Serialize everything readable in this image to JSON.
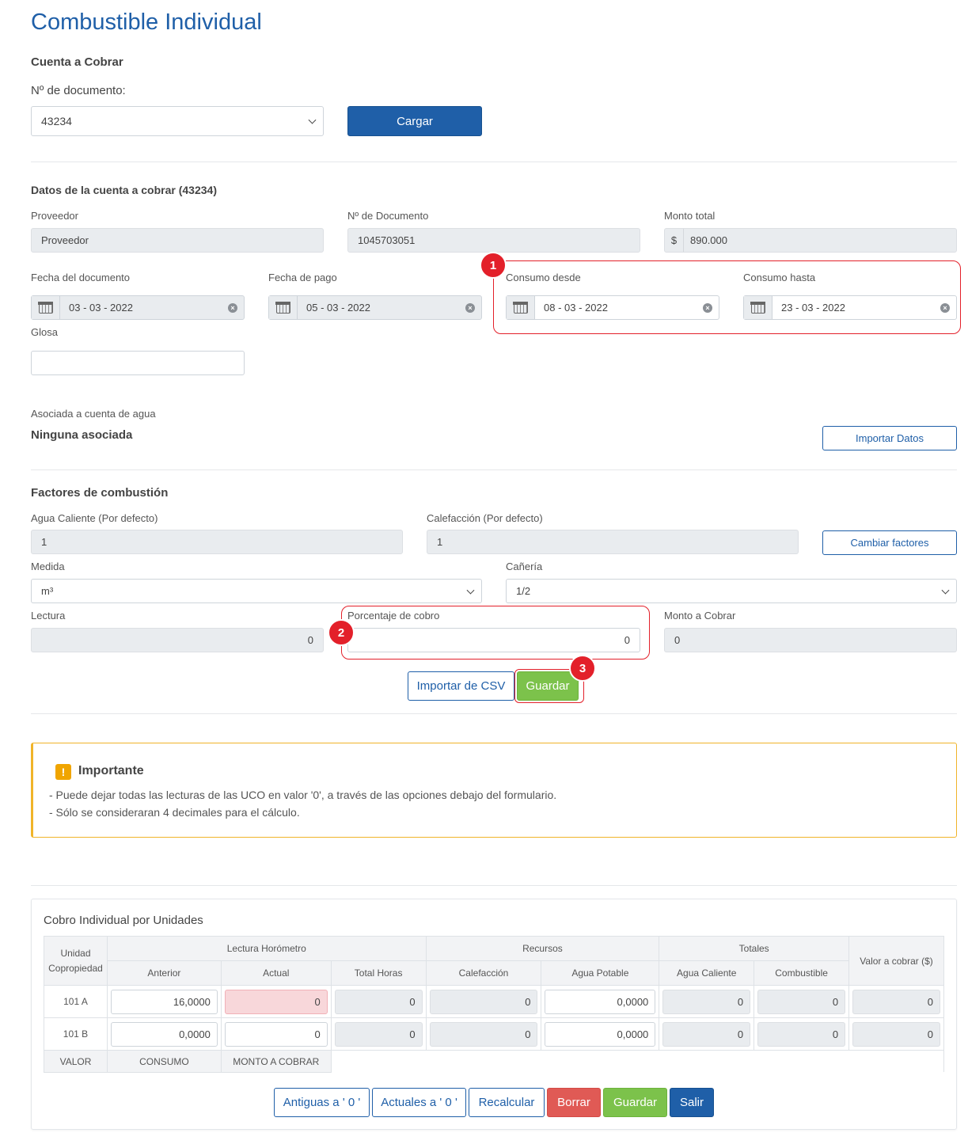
{
  "page": {
    "title": "Combustible Individual"
  },
  "cuenta": {
    "heading": "Cuenta a Cobrar",
    "doc_label": "Nº de documento:",
    "doc_value": "43234",
    "load_button": "Cargar"
  },
  "datos": {
    "heading": "Datos de la cuenta a cobrar (43234)",
    "proveedor_label": "Proveedor",
    "proveedor_value": "Proveedor",
    "documento_label": "Nº de Documento",
    "documento_value": "1045703051",
    "monto_label": "Monto total",
    "monto_prefix": "$",
    "monto_value": "890.000",
    "fecha_doc_label": "Fecha del documento",
    "fecha_doc_value": "03 - 03 - 2022",
    "fecha_pago_label": "Fecha de pago",
    "fecha_pago_value": "05 - 03 - 2022",
    "consumo_desde_label": "Consumo desde",
    "consumo_desde_value": "08 - 03 - 2022",
    "consumo_hasta_label": "Consumo hasta",
    "consumo_hasta_value": "23 - 03 - 2022",
    "glosa_label": "Glosa",
    "glosa_value": "",
    "asociada_label": "Asociada a cuenta de agua",
    "asociada_value": "Ninguna asociada",
    "importar_datos_button": "Importar Datos"
  },
  "factores": {
    "heading": "Factores de combustión",
    "agua_label": "Agua Caliente (Por defecto)",
    "agua_value": "1",
    "calef_label": "Calefacción (Por defecto)",
    "calef_value": "1",
    "cambiar_button": "Cambiar factores",
    "medida_label": "Medida",
    "medida_value": "m³",
    "caneria_label": "Cañería",
    "caneria_value": "1/2",
    "lectura_label": "Lectura",
    "lectura_value": "0",
    "porcentaje_label": "Porcentaje de cobro",
    "porcentaje_value": "0",
    "monto_cobrar_label": "Monto a Cobrar",
    "monto_cobrar_value": "0",
    "importar_csv_button": "Importar de CSV",
    "guardar_button": "Guardar"
  },
  "badges": {
    "b1": "1",
    "b2": "2",
    "b3": "3"
  },
  "alert": {
    "icon": "!",
    "title": "Importante",
    "line1": "- Puede dejar todas las lecturas de las UCO en valor '0', a través de las opciones debajo del formulario.",
    "line2": "- Sólo se consideraran 4 decimales para el cálculo."
  },
  "table": {
    "title": "Cobro Individual por Unidades",
    "headers": {
      "unidad_line1": "Unidad",
      "unidad_line2": "Copropiedad",
      "lectura": "Lectura Horómetro",
      "recursos": "Recursos",
      "totales": "Totales",
      "valor": "Valor a cobrar ($)",
      "anterior": "Anterior",
      "actual": "Actual",
      "total_horas": "Total Horas",
      "calefaccion": "Calefacción",
      "agua_potable": "Agua Potable",
      "agua_caliente": "Agua Caliente",
      "combustible": "Combustible"
    },
    "rows": [
      {
        "unit": "101 A",
        "anterior": "16,0000",
        "actual": "0",
        "total_horas": "0",
        "calefaccion": "0",
        "agua_potable": "0,0000",
        "agua_caliente": "0",
        "combustible": "0",
        "valor": "0"
      },
      {
        "unit": "101 B",
        "anterior": "0,0000",
        "actual": "0",
        "total_horas": "0",
        "calefaccion": "0",
        "agua_potable": "0,0000",
        "agua_caliente": "0",
        "combustible": "0",
        "valor": "0"
      }
    ],
    "footer": {
      "valor": "VALOR",
      "consumo": "CONSUMO",
      "monto": "MONTO A COBRAR"
    }
  },
  "actions": {
    "antiguas": "Antiguas a ' 0 '",
    "actuales": "Actuales a ' 0 '",
    "recalcular": "Recalcular",
    "borrar": "Borrar",
    "guardar": "Guardar",
    "salir": "Salir"
  },
  "colors": {
    "primary": "#1f5fa8",
    "success": "#7cc24b",
    "danger": "#e05a55",
    "highlight": "#e3202a",
    "warning": "#f0b429"
  }
}
